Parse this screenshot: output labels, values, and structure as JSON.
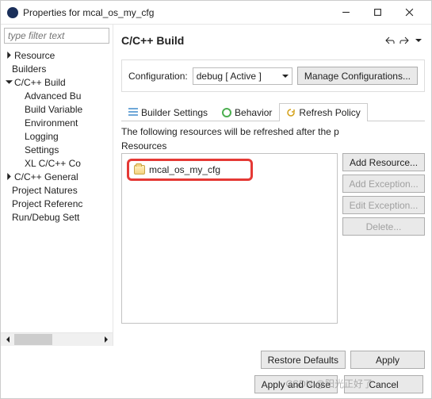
{
  "window": {
    "title": "Properties for mcal_os_my_cfg"
  },
  "side": {
    "filterPlaceholder": "type filter text",
    "items": {
      "resource": "Resource",
      "builders": "Builders",
      "cbuild": "C/C++ Build",
      "adv": "Advanced Bu",
      "bvars": "Build Variable",
      "env": "Environment",
      "log": "Logging",
      "set": "Settings",
      "xl": "XL C/C++ Co",
      "cgen": "C/C++ General",
      "pnat": "Project Natures",
      "pref": "Project Referenc",
      "rdbg": "Run/Debug Sett"
    }
  },
  "header": {
    "title": "C/C++ Build"
  },
  "config": {
    "label": "Configuration:",
    "value": "debug  [ Active ]",
    "manage": "Manage Configurations..."
  },
  "tabs": {
    "builder": "Builder Settings",
    "behavior": "Behavior",
    "refresh": "Refresh Policy"
  },
  "refresh": {
    "msg": "The following resources will be refreshed after the p",
    "resLabel": "Resources",
    "item": "mcal_os_my_cfg",
    "btns": {
      "addRes": "Add Resource...",
      "addEx": "Add Exception...",
      "editEx": "Edit Exception...",
      "del": "Delete..."
    }
  },
  "footer": {
    "restore": "Restore Defaults",
    "apply": "Apply",
    "applyClose": "Apply and Close",
    "cancel": "Cancel"
  },
  "watermark": "CSDN @阳光正好了"
}
